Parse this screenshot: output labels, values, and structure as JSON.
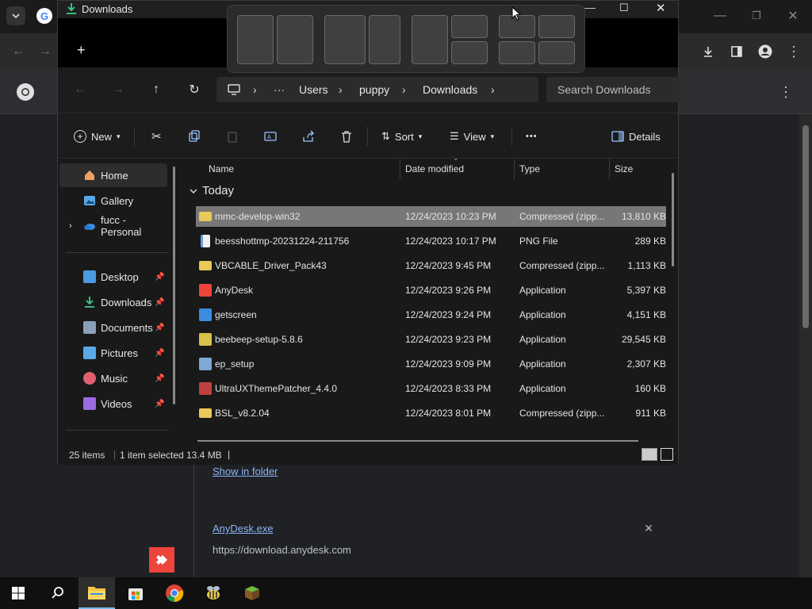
{
  "chrome": {
    "download_entries": [
      {
        "link": "Show in folder"
      },
      {
        "name": "AnyDesk.exe",
        "url": "https://download.anydesk.com"
      }
    ],
    "close_glyph": "✕"
  },
  "explorer": {
    "title": "Downloads",
    "new_tab_glyph": "+",
    "breadcrumb": [
      "Users",
      "puppy",
      "Downloads"
    ],
    "search_placeholder": "Search Downloads",
    "commands": {
      "new": "New",
      "sort": "Sort",
      "view": "View",
      "more": "•••",
      "details": "Details"
    },
    "nav": [
      {
        "label": "Home"
      },
      {
        "label": "Gallery"
      },
      {
        "label": "fucc - Personal"
      },
      {
        "label": "Desktop"
      },
      {
        "label": "Downloads"
      },
      {
        "label": "Documents"
      },
      {
        "label": "Pictures"
      },
      {
        "label": "Music"
      },
      {
        "label": "Videos"
      }
    ],
    "columns": {
      "name": "Name",
      "date": "Date modified",
      "type": "Type",
      "size": "Size"
    },
    "group": "Today",
    "files": [
      {
        "name": "mmc-develop-win32",
        "date": "12/24/2023 10:23 PM",
        "type": "Compressed (zipp...",
        "size": "13,810 KB",
        "icon": "zip-folder-icon",
        "color": "#e8c95a"
      },
      {
        "name": "beesshottmp-20231224-211756",
        "date": "12/24/2023 10:17 PM",
        "type": "PNG File",
        "size": "289 KB",
        "icon": "png-file-icon",
        "color": "#6aa0e0"
      },
      {
        "name": "VBCABLE_Driver_Pack43",
        "date": "12/24/2023 9:45 PM",
        "type": "Compressed (zipp...",
        "size": "1,113 KB",
        "icon": "zip-folder-icon",
        "color": "#e8c95a"
      },
      {
        "name": "AnyDesk",
        "date": "12/24/2023 9:26 PM",
        "type": "Application",
        "size": "5,397 KB",
        "icon": "anydesk-icon",
        "color": "#ef443b"
      },
      {
        "name": "getscreen",
        "date": "12/24/2023 9:24 PM",
        "type": "Application",
        "size": "4,151 KB",
        "icon": "getscreen-icon",
        "color": "#3b8be0"
      },
      {
        "name": "beebeep-setup-5.8.6",
        "date": "12/24/2023 9:23 PM",
        "type": "Application",
        "size": "29,545 KB",
        "icon": "bee-icon",
        "color": "#d7c24a"
      },
      {
        "name": "ep_setup",
        "date": "12/24/2023 9:09 PM",
        "type": "Application",
        "size": "2,307 KB",
        "icon": "app-window-icon",
        "color": "#7fa8d8"
      },
      {
        "name": "UltraUXThemePatcher_4.4.0",
        "date": "12/24/2023 8:33 PM",
        "type": "Application",
        "size": "160 KB",
        "icon": "patcher-icon",
        "color": "#c04040"
      },
      {
        "name": "BSL_v8.2.04",
        "date": "12/24/2023 8:01 PM",
        "type": "Compressed (zipp...",
        "size": "911 KB",
        "icon": "zip-folder-icon",
        "color": "#e8c95a"
      }
    ],
    "status": {
      "items": "25 items",
      "selected": "1 item selected",
      "size": "13.4 MB"
    }
  },
  "colors": {
    "accent": "#76b9ed",
    "selection": "#777777",
    "link": "#8ab4f8"
  }
}
